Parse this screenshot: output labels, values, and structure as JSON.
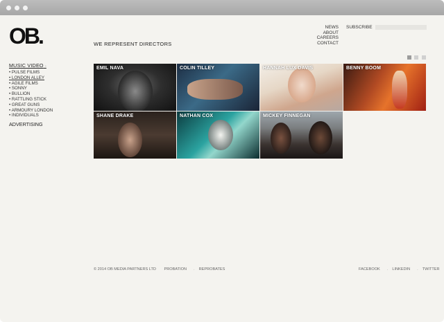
{
  "brand": {
    "logo_text": "OB."
  },
  "header": {
    "tagline": "WE REPRESENT DIRECTORS",
    "nav": [
      "NEWS",
      "ABOUT",
      "CAREERS",
      "CONTACT"
    ],
    "subscribe_label": "SUBSCRIBE",
    "subscribe_value": ""
  },
  "sidebar": {
    "category": "MUSIC VIDEO",
    "caret": "›",
    "items": [
      "PULSE FILMS",
      "LONDON ALLEY",
      "AGILE FILMS",
      "SONNY",
      "BULLION",
      "RATTLING STICK",
      "GREAT GUNS",
      "ARMOURY LONDON",
      "INDIVIDUALS"
    ],
    "bullet": "•",
    "second_category": "ADVERTISING"
  },
  "directors": [
    {
      "name": "EMIL NAVA"
    },
    {
      "name": "COLIN TILLEY"
    },
    {
      "name": "HANNAH LUX DAVIS"
    },
    {
      "name": "BENNY BOOM"
    },
    {
      "name": "SHANE DRAKE"
    },
    {
      "name": "NATHAN COX"
    },
    {
      "name": "MICKEY FINNEGAN"
    }
  ],
  "footer": {
    "copyright": "© 2014 OB MEDIA PARTNERS LTD",
    "left_links": [
      "PROBATION",
      "REPROBATES"
    ],
    "right_links": [
      "FACEBOOK",
      "LINKEDIN",
      "TWITTER"
    ],
    "separator": "."
  },
  "colors": {
    "page_bg": "#f4f3ef",
    "chrome": "#b0b0b0"
  }
}
